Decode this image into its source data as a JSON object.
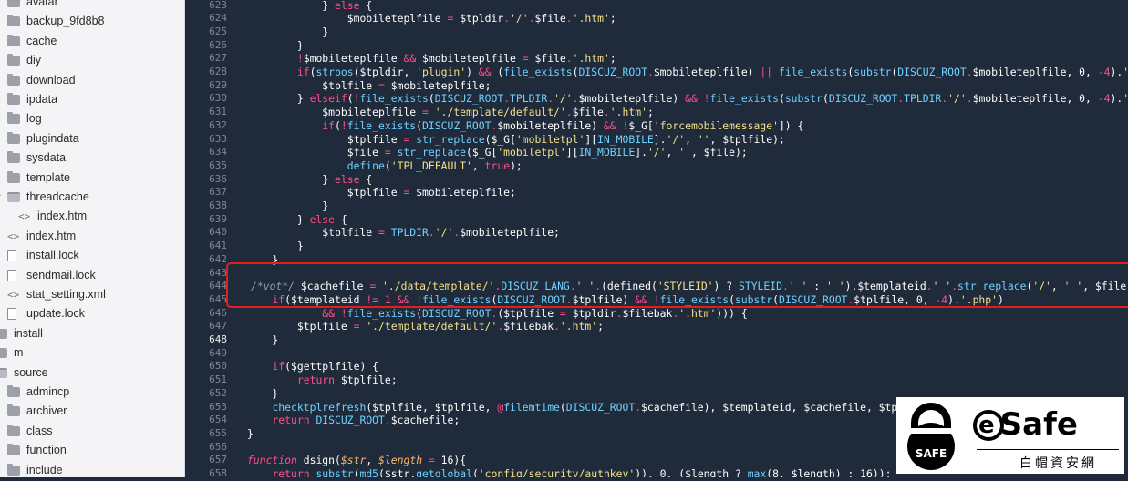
{
  "sidebar": {
    "items": [
      {
        "label": "avatar",
        "type": "folder",
        "indent": 1,
        "twisty": ">"
      },
      {
        "label": "backup_9fd8b8",
        "type": "folder",
        "indent": 1,
        "twisty": ">"
      },
      {
        "label": "cache",
        "type": "folder",
        "indent": 1,
        "twisty": ">"
      },
      {
        "label": "diy",
        "type": "folder",
        "indent": 1,
        "twisty": ">"
      },
      {
        "label": "download",
        "type": "folder",
        "indent": 1,
        "twisty": ">"
      },
      {
        "label": "ipdata",
        "type": "folder",
        "indent": 1,
        "twisty": ">"
      },
      {
        "label": "log",
        "type": "folder",
        "indent": 1,
        "twisty": ">"
      },
      {
        "label": "plugindata",
        "type": "folder",
        "indent": 1,
        "twisty": ">"
      },
      {
        "label": "sysdata",
        "type": "folder",
        "indent": 1,
        "twisty": ">"
      },
      {
        "label": "template",
        "type": "folder",
        "indent": 1,
        "twisty": ">"
      },
      {
        "label": "threadcache",
        "type": "folder-open",
        "indent": 1,
        "twisty": "v"
      },
      {
        "label": "index.htm",
        "type": "code",
        "indent": 2,
        "twisty": ""
      },
      {
        "label": "index.htm",
        "type": "code",
        "indent": 1,
        "twisty": ""
      },
      {
        "label": "install.lock",
        "type": "file",
        "indent": 1,
        "twisty": ""
      },
      {
        "label": "sendmail.lock",
        "type": "file",
        "indent": 1,
        "twisty": ""
      },
      {
        "label": "stat_setting.xml",
        "type": "code",
        "indent": 1,
        "twisty": ""
      },
      {
        "label": "update.lock",
        "type": "file",
        "indent": 1,
        "twisty": ""
      },
      {
        "label": "install",
        "type": "folder",
        "indent": 0,
        "twisty": ""
      },
      {
        "label": "m",
        "type": "folder",
        "indent": 0,
        "twisty": ""
      },
      {
        "label": "source",
        "type": "folder-open",
        "indent": 0,
        "twisty": ""
      },
      {
        "label": "admincp",
        "type": "folder",
        "indent": 1,
        "twisty": ">"
      },
      {
        "label": "archiver",
        "type": "folder",
        "indent": 1,
        "twisty": ">"
      },
      {
        "label": "class",
        "type": "folder",
        "indent": 1,
        "twisty": ">"
      },
      {
        "label": "function",
        "type": "folder",
        "indent": 1,
        "twisty": ">"
      },
      {
        "label": "include",
        "type": "folder",
        "indent": 1,
        "twisty": ">"
      }
    ]
  },
  "editor": {
    "first_line": 623,
    "current_line": 648,
    "lines": [
      [
        [
          "            ",
          "w"
        ],
        [
          "} ",
          "w"
        ],
        [
          "else",
          "k"
        ],
        [
          " {",
          "w"
        ]
      ],
      [
        [
          "                ",
          "w"
        ],
        [
          "$mobileteplfile",
          "w"
        ],
        [
          " = ",
          "k"
        ],
        [
          "$tpldir",
          "w"
        ],
        [
          ".",
          "k"
        ],
        [
          "'/'",
          "s"
        ],
        [
          ".",
          "k"
        ],
        [
          "$file",
          "w"
        ],
        [
          ".",
          "k"
        ],
        [
          "'.htm'",
          "s"
        ],
        [
          ";",
          "w"
        ]
      ],
      [
        [
          "            }",
          "w"
        ]
      ],
      [
        [
          "        }",
          "w"
        ]
      ],
      [
        [
          "        ",
          "w"
        ],
        [
          "!",
          "k"
        ],
        [
          "$mobileteplfile ",
          "w"
        ],
        [
          "&&",
          "k"
        ],
        [
          " $mobileteplfile ",
          "w"
        ],
        [
          "=",
          "k"
        ],
        [
          " $file",
          "w"
        ],
        [
          ".",
          "k"
        ],
        [
          "'.htm'",
          "s"
        ],
        [
          ";",
          "w"
        ]
      ],
      [
        [
          "        ",
          "w"
        ],
        [
          "if",
          "k"
        ],
        [
          "(",
          "w"
        ],
        [
          "strpos",
          "f"
        ],
        [
          "($tpldir, ",
          "w"
        ],
        [
          "'plugin'",
          "s"
        ],
        [
          ") ",
          "w"
        ],
        [
          "&&",
          "k"
        ],
        [
          " (",
          "w"
        ],
        [
          "file_exists",
          "f"
        ],
        [
          "(",
          "w"
        ],
        [
          "DISCUZ_ROOT",
          "f"
        ],
        [
          ".",
          "k"
        ],
        [
          "$mobileteplfile) ",
          "w"
        ],
        [
          "||",
          "k"
        ],
        [
          " ",
          "w"
        ],
        [
          "file_exists",
          "f"
        ],
        [
          "(",
          "w"
        ],
        [
          "substr",
          "f"
        ],
        [
          "(",
          "w"
        ],
        [
          "DISCUZ_ROOT",
          "f"
        ],
        [
          ".",
          "k"
        ],
        [
          "$mobileteplfile, 0, ",
          "w"
        ],
        [
          "-4",
          "k"
        ],
        [
          ").",
          "w"
        ],
        [
          "'.ph",
          "s"
        ]
      ],
      [
        [
          "            $tplfile ",
          "w"
        ],
        [
          "=",
          "k"
        ],
        [
          " $mobileteplfile;",
          "w"
        ]
      ],
      [
        [
          "        } ",
          "w"
        ],
        [
          "elseif",
          "k"
        ],
        [
          "(",
          "w"
        ],
        [
          "!",
          "k"
        ],
        [
          "file_exists",
          "f"
        ],
        [
          "(",
          "w"
        ],
        [
          "DISCUZ_ROOT",
          "f"
        ],
        [
          ".",
          "k"
        ],
        [
          "TPLDIR",
          "f"
        ],
        [
          ".",
          "k"
        ],
        [
          "'/'",
          "s"
        ],
        [
          ".",
          "k"
        ],
        [
          "$mobileteplfile) ",
          "w"
        ],
        [
          "&&",
          "k"
        ],
        [
          " ",
          "w"
        ],
        [
          "!",
          "k"
        ],
        [
          "file_exists",
          "f"
        ],
        [
          "(",
          "w"
        ],
        [
          "substr",
          "f"
        ],
        [
          "(",
          "w"
        ],
        [
          "DISCUZ_ROOT",
          "f"
        ],
        [
          ".",
          "k"
        ],
        [
          "TPLDIR",
          "f"
        ],
        [
          ".",
          "k"
        ],
        [
          "'/'",
          "s"
        ],
        [
          ".",
          "k"
        ],
        [
          "$mobileteplfile, 0, ",
          "w"
        ],
        [
          "-4",
          "k"
        ],
        [
          ").",
          "w"
        ],
        [
          "'.ph",
          "s"
        ]
      ],
      [
        [
          "            $mobileteplfile ",
          "w"
        ],
        [
          "=",
          "k"
        ],
        [
          " ",
          "w"
        ],
        [
          "'./template/default/'",
          "s"
        ],
        [
          ".",
          "k"
        ],
        [
          "$file",
          "w"
        ],
        [
          ".",
          "k"
        ],
        [
          "'.htm'",
          "s"
        ],
        [
          ";",
          "w"
        ]
      ],
      [
        [
          "            ",
          "w"
        ],
        [
          "if",
          "k"
        ],
        [
          "(",
          "w"
        ],
        [
          "!",
          "k"
        ],
        [
          "file_exists",
          "f"
        ],
        [
          "(",
          "w"
        ],
        [
          "DISCUZ_ROOT",
          "f"
        ],
        [
          ".",
          "k"
        ],
        [
          "$mobileteplfile) ",
          "w"
        ],
        [
          "&&",
          "k"
        ],
        [
          " ",
          "w"
        ],
        [
          "!",
          "k"
        ],
        [
          "$_G[",
          "w"
        ],
        [
          "'forcemobilemessage'",
          "s"
        ],
        [
          "]) {",
          "w"
        ]
      ],
      [
        [
          "                $tplfile ",
          "w"
        ],
        [
          "=",
          "k"
        ],
        [
          " ",
          "w"
        ],
        [
          "str_replace",
          "f"
        ],
        [
          "($_G[",
          "w"
        ],
        [
          "'mobiletpl'",
          "s"
        ],
        [
          "][",
          "w"
        ],
        [
          "IN_MOBILE",
          "f"
        ],
        [
          "].",
          "w"
        ],
        [
          "'/'",
          "s"
        ],
        [
          ", ",
          "w"
        ],
        [
          "''",
          "s"
        ],
        [
          ", $tplfile);",
          "w"
        ]
      ],
      [
        [
          "                $file ",
          "w"
        ],
        [
          "=",
          "k"
        ],
        [
          " ",
          "w"
        ],
        [
          "str_replace",
          "f"
        ],
        [
          "($_G[",
          "w"
        ],
        [
          "'mobiletpl'",
          "s"
        ],
        [
          "][",
          "w"
        ],
        [
          "IN_MOBILE",
          "f"
        ],
        [
          "].",
          "w"
        ],
        [
          "'/'",
          "s"
        ],
        [
          ", ",
          "w"
        ],
        [
          "''",
          "s"
        ],
        [
          ", $file);",
          "w"
        ]
      ],
      [
        [
          "                ",
          "w"
        ],
        [
          "define",
          "f"
        ],
        [
          "(",
          "w"
        ],
        [
          "'TPL_DEFAULT'",
          "s"
        ],
        [
          ", ",
          "w"
        ],
        [
          "true",
          "k"
        ],
        [
          ");",
          "w"
        ]
      ],
      [
        [
          "            } ",
          "w"
        ],
        [
          "else",
          "k"
        ],
        [
          " {",
          "w"
        ]
      ],
      [
        [
          "                $tplfile ",
          "w"
        ],
        [
          "=",
          "k"
        ],
        [
          " $mobileteplfile;",
          "w"
        ]
      ],
      [
        [
          "            }",
          "w"
        ]
      ],
      [
        [
          "        } ",
          "w"
        ],
        [
          "else",
          "k"
        ],
        [
          " {",
          "w"
        ]
      ],
      [
        [
          "            $tplfile ",
          "w"
        ],
        [
          "=",
          "k"
        ],
        [
          " ",
          "w"
        ],
        [
          "TPLDIR",
          "f"
        ],
        [
          ".",
          "k"
        ],
        [
          "'/'",
          "s"
        ],
        [
          ".",
          "k"
        ],
        [
          "$mobileteplfile;",
          "w"
        ]
      ],
      [
        [
          "        }",
          "w"
        ]
      ],
      [
        [
          "    }",
          "w"
        ]
      ],
      [
        [
          "",
          "w"
        ]
      ],
      [
        [
          "/*vot*/",
          "c"
        ],
        [
          " $cachefile ",
          "w"
        ],
        [
          "=",
          "k"
        ],
        [
          " ",
          "w"
        ],
        [
          "'./data/template/'",
          "s"
        ],
        [
          ".",
          "k"
        ],
        [
          "DISCUZ_LANG",
          "f"
        ],
        [
          ".",
          "k"
        ],
        [
          "'_'",
          "s"
        ],
        [
          ".",
          "k"
        ],
        [
          "(defined(",
          "w"
        ],
        [
          "'STYLEID'",
          "s"
        ],
        [
          ") ? ",
          "w"
        ],
        [
          "STYLEID",
          "f"
        ],
        [
          ".",
          "k"
        ],
        [
          "'_'",
          "s"
        ],
        [
          " : ",
          "w"
        ],
        [
          "'_'",
          "s"
        ],
        [
          ").",
          "w"
        ],
        [
          "$templateid",
          "w"
        ],
        [
          ".",
          "k"
        ],
        [
          "'_'",
          "s"
        ],
        [
          ".",
          "k"
        ],
        [
          "str_replace",
          "f"
        ],
        [
          "(",
          "w"
        ],
        [
          "'/'",
          "s"
        ],
        [
          ", ",
          "w"
        ],
        [
          "'_'",
          "s"
        ],
        [
          ", $file)",
          "w"
        ]
      ],
      [
        [
          "    ",
          "w"
        ],
        [
          "if",
          "k"
        ],
        [
          "($templateid ",
          "w"
        ],
        [
          "!= 1 && ",
          "k"
        ],
        [
          "!",
          "k"
        ],
        [
          "file_exists",
          "f"
        ],
        [
          "(",
          "w"
        ],
        [
          "DISCUZ_ROOT",
          "f"
        ],
        [
          ".",
          "k"
        ],
        [
          "$tplfile) ",
          "w"
        ],
        [
          "&&",
          "k"
        ],
        [
          " ",
          "w"
        ],
        [
          "!",
          "k"
        ],
        [
          "file_exists",
          "f"
        ],
        [
          "(",
          "w"
        ],
        [
          "substr",
          "f"
        ],
        [
          "(",
          "w"
        ],
        [
          "DISCUZ_ROOT",
          "f"
        ],
        [
          ".",
          "k"
        ],
        [
          "$tplfile, 0, ",
          "w"
        ],
        [
          "-4",
          "k"
        ],
        [
          ").",
          "w"
        ],
        [
          "'.php'",
          "s"
        ],
        [
          ")",
          "w"
        ]
      ],
      [
        [
          "            ",
          "w"
        ],
        [
          "&&",
          "k"
        ],
        [
          " ",
          "w"
        ],
        [
          "!",
          "k"
        ],
        [
          "file_exists",
          "f"
        ],
        [
          "(",
          "w"
        ],
        [
          "DISCUZ_ROOT",
          "f"
        ],
        [
          ".",
          "k"
        ],
        [
          "($tplfile ",
          "w"
        ],
        [
          "=",
          "k"
        ],
        [
          " $tpldir",
          "w"
        ],
        [
          ".",
          "k"
        ],
        [
          "$filebak",
          "w"
        ],
        [
          ".",
          "k"
        ],
        [
          "'.htm'",
          "s"
        ],
        [
          "))) {",
          "w"
        ]
      ],
      [
        [
          "        $tplfile ",
          "w"
        ],
        [
          "=",
          "k"
        ],
        [
          " ",
          "w"
        ],
        [
          "'./template/default/'",
          "s"
        ],
        [
          ".",
          "k"
        ],
        [
          "$filebak",
          "w"
        ],
        [
          ".",
          "k"
        ],
        [
          "'.htm'",
          "s"
        ],
        [
          ";",
          "w"
        ]
      ],
      [
        [
          "    }",
          "w"
        ]
      ],
      [
        [
          "",
          "w"
        ]
      ],
      [
        [
          "    ",
          "w"
        ],
        [
          "if",
          "k"
        ],
        [
          "($gettplfile) {",
          "w"
        ]
      ],
      [
        [
          "        ",
          "w"
        ],
        [
          "return",
          "k"
        ],
        [
          " $tplfile;",
          "w"
        ]
      ],
      [
        [
          "    }",
          "w"
        ]
      ],
      [
        [
          "    ",
          "w"
        ],
        [
          "checktplrefresh",
          "f"
        ],
        [
          "($tplfile, $tplfile, ",
          "w"
        ],
        [
          "@",
          "k"
        ],
        [
          "filemtime",
          "f"
        ],
        [
          "(",
          "w"
        ],
        [
          "DISCUZ_ROOT",
          "f"
        ],
        [
          ".",
          "k"
        ],
        [
          "$cachefile), $templateid, $cachefile, $tp",
          "w"
        ]
      ],
      [
        [
          "    ",
          "w"
        ],
        [
          "return",
          "k"
        ],
        [
          " ",
          "w"
        ],
        [
          "DISCUZ_ROOT",
          "f"
        ],
        [
          ".",
          "k"
        ],
        [
          "$cachefile;",
          "w"
        ]
      ],
      [
        [
          "}",
          "w"
        ]
      ],
      [
        [
          "",
          "w"
        ]
      ],
      [
        [
          "function",
          "k"
        ],
        [
          " dsign(",
          "w"
        ],
        [
          "$str",
          "i"
        ],
        [
          ", ",
          "w"
        ],
        [
          "$length",
          "i"
        ],
        [
          " ",
          "w"
        ],
        [
          "=",
          "k"
        ],
        [
          " 16){",
          "w"
        ]
      ],
      [
        [
          "    ",
          "w"
        ],
        [
          "return",
          "k"
        ],
        [
          " ",
          "w"
        ],
        [
          "substr",
          "f"
        ],
        [
          "(",
          "w"
        ],
        [
          "md5",
          "f"
        ],
        [
          "($str.",
          "w"
        ],
        [
          "getglobal",
          "f"
        ],
        [
          "(",
          "w"
        ],
        [
          "'config/security/authkey'",
          "s"
        ],
        [
          ")), 0, ($length ? ",
          "w"
        ],
        [
          "max",
          "f"
        ],
        [
          "(8, $length) : 16));",
          "w"
        ]
      ]
    ]
  },
  "watermark": {
    "lock_label": "SAFE",
    "brand": "Safe",
    "brand_prefix": "e",
    "subtitle": "白帽資安網"
  },
  "colors": {
    "editor_bg": "#1f2a3a",
    "keyword": "#ff4f8b",
    "string": "#f4e089",
    "function": "#6fd1ff",
    "comment": "#8f9bb0",
    "italic_param": "#ffb86b",
    "callout": "#e51d1d"
  }
}
